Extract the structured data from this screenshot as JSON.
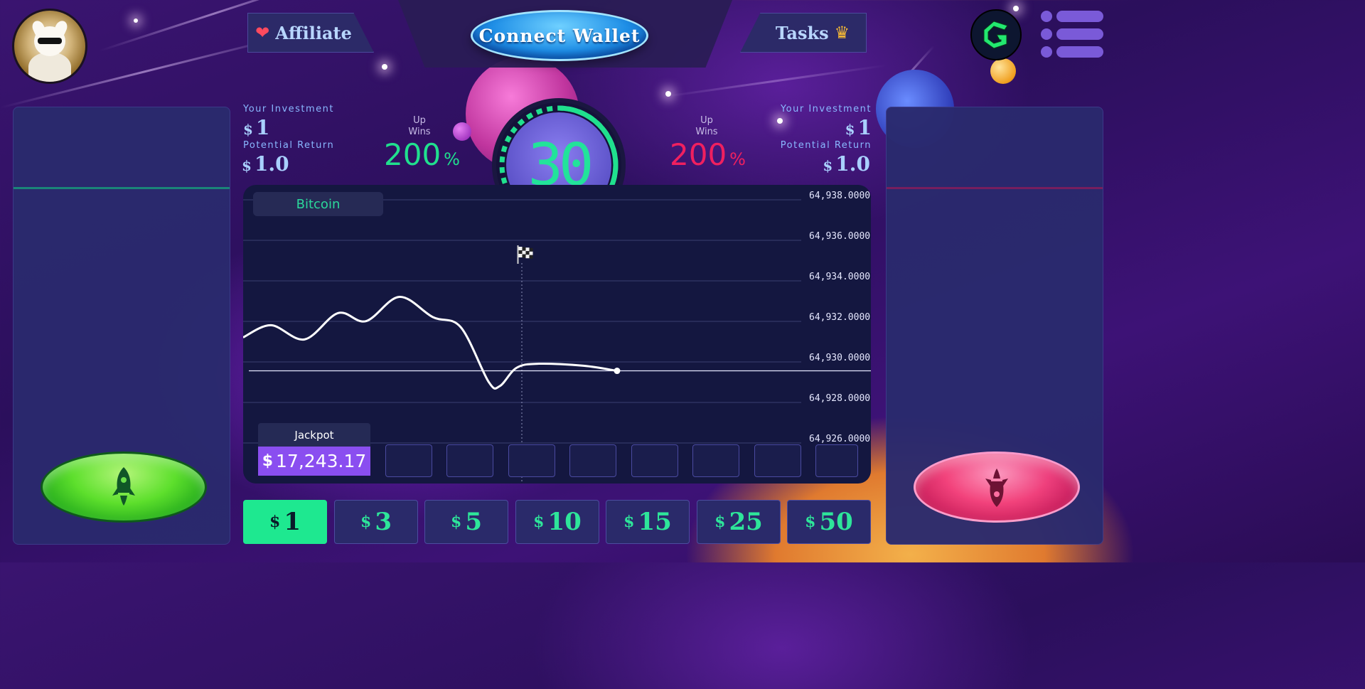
{
  "header": {
    "affiliate_label": "Affiliate",
    "connect_wallet_label": "Connect Wallet",
    "tasks_label": "Tasks",
    "heart_icon": "heart-icon",
    "crown_icon": "crown-icon"
  },
  "left_stats": {
    "investment_label": "Your Investment",
    "currency": "$",
    "investment_value": "1",
    "potential_label": "Potential Return",
    "potential_value": "1.0"
  },
  "right_stats": {
    "investment_label": "Your Investment",
    "currency": "$",
    "investment_value": "1",
    "potential_label": "Potential Return",
    "potential_value": "1.0"
  },
  "up_odds": {
    "line1": "Up",
    "line2": "Wins",
    "value": "200",
    "unit": "%",
    "color": "#20e08e"
  },
  "down_odds": {
    "line1": "Up",
    "line2": "Wins",
    "value": "200",
    "unit": "%",
    "color": "#f0205f"
  },
  "timer": {
    "value": "30",
    "progress_fraction": 0.62,
    "color": "#20e08e"
  },
  "asset": {
    "name": "Bitcoin"
  },
  "jackpot": {
    "label": "Jackpot",
    "currency": "$",
    "value": "17,243.17"
  },
  "bets": {
    "currency": "$",
    "options": [
      "1",
      "3",
      "5",
      "10",
      "15",
      "25",
      "50"
    ],
    "selected": "1"
  },
  "chart_data": {
    "type": "line",
    "ylim": [
      64925,
      64939
    ],
    "ytick_labels": [
      "64,938.0000",
      "64,936.0000",
      "64,934.0000",
      "64,932.0000",
      "64,930.0000",
      "64,928.0000",
      "64,926.0000"
    ],
    "yticks": [
      64938,
      64936,
      64934,
      64932,
      64930,
      64928,
      64926
    ],
    "x_range": [
      0,
      100
    ],
    "finish_x": 50,
    "baseline_y": 64929.35,
    "series": [
      {
        "x": [
          0,
          5,
          11,
          17,
          22,
          28,
          34,
          39,
          44,
          46,
          49,
          53,
          61,
          67
        ],
        "y": [
          64931.0,
          64931.6,
          64930.9,
          64932.2,
          64931.8,
          64933.0,
          64932.0,
          64931.5,
          64928.8,
          64928.6,
          64929.5,
          64929.7,
          64929.6,
          64929.35
        ]
      }
    ],
    "grid": true,
    "icons": {
      "finish": "checkered-flag-icon"
    }
  },
  "colors": {
    "up": "#1ee890",
    "down": "#f3407f",
    "panel": "#2a2a6e",
    "up_line": "#1a8a7a",
    "down_line": "#7a1f5e"
  }
}
